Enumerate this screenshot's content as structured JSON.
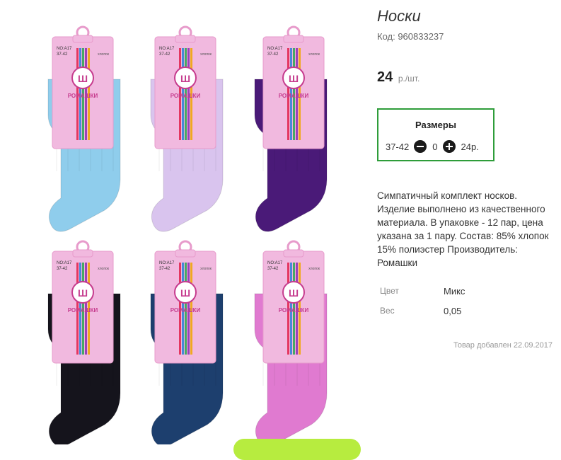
{
  "product": {
    "title": "Носки",
    "code": "Код: 960833237",
    "price": "24",
    "price_unit": "р./шт."
  },
  "sizes": {
    "title": "Размеры",
    "items": [
      {
        "size": "37-42",
        "quantity": "0",
        "price": "24р."
      }
    ]
  },
  "description": "Симпатичный комплект носков. Изделие выполнено из качественного материала. В упаковке - 12 пар, цена указана за 1 пару. Состав: 85% хлопок 15% полиэстер Производитель: Ромашки",
  "attributes": [
    {
      "label": "Цвет",
      "value": "Микс"
    },
    {
      "label": "Вес",
      "value": "0,05"
    }
  ],
  "added_date": "Товар добавлен 22.09.2017",
  "photo": {
    "brand": "РОМАШКИ",
    "model": "NO:A17",
    "size": "37-42",
    "material": "хлопок",
    "socks": [
      {
        "color": "#8fcdec"
      },
      {
        "color": "#d9c4ee"
      },
      {
        "color": "#4a1a78"
      },
      {
        "color": "#15141c"
      },
      {
        "color": "#1d3f6e"
      },
      {
        "color": "#e07ad0"
      }
    ],
    "tag_color": "#f1b9df"
  },
  "colors": {
    "accent_border": "#2e9d3a",
    "cta": "#b7ec3f"
  }
}
